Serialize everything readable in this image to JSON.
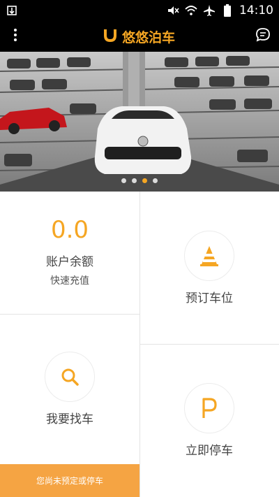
{
  "status_bar": {
    "time": "14:10",
    "icons": [
      "download-icon",
      "mute-icon",
      "wifi-icon",
      "airplane-icon",
      "battery-icon"
    ]
  },
  "app_bar": {
    "title": "悠悠泊车",
    "menu_icon": "more-vertical-icon",
    "message_icon": "chat-bubble-icon"
  },
  "banner": {
    "page_count": 4,
    "active_page": 3
  },
  "account": {
    "balance": "0.0",
    "label": "账户余额",
    "recharge": "快速充值"
  },
  "reserve": {
    "label": "预订车位",
    "icon": "traffic-cone-icon"
  },
  "find_car": {
    "label": "我要找车",
    "icon": "search-icon"
  },
  "park_now": {
    "label": "立即停车",
    "icon": "parking-p-icon"
  },
  "notice": {
    "text": "您尚未预定或停车"
  },
  "colors": {
    "accent": "#f5a623",
    "notice_bg": "#f5a443",
    "bar_bg": "#000000"
  }
}
